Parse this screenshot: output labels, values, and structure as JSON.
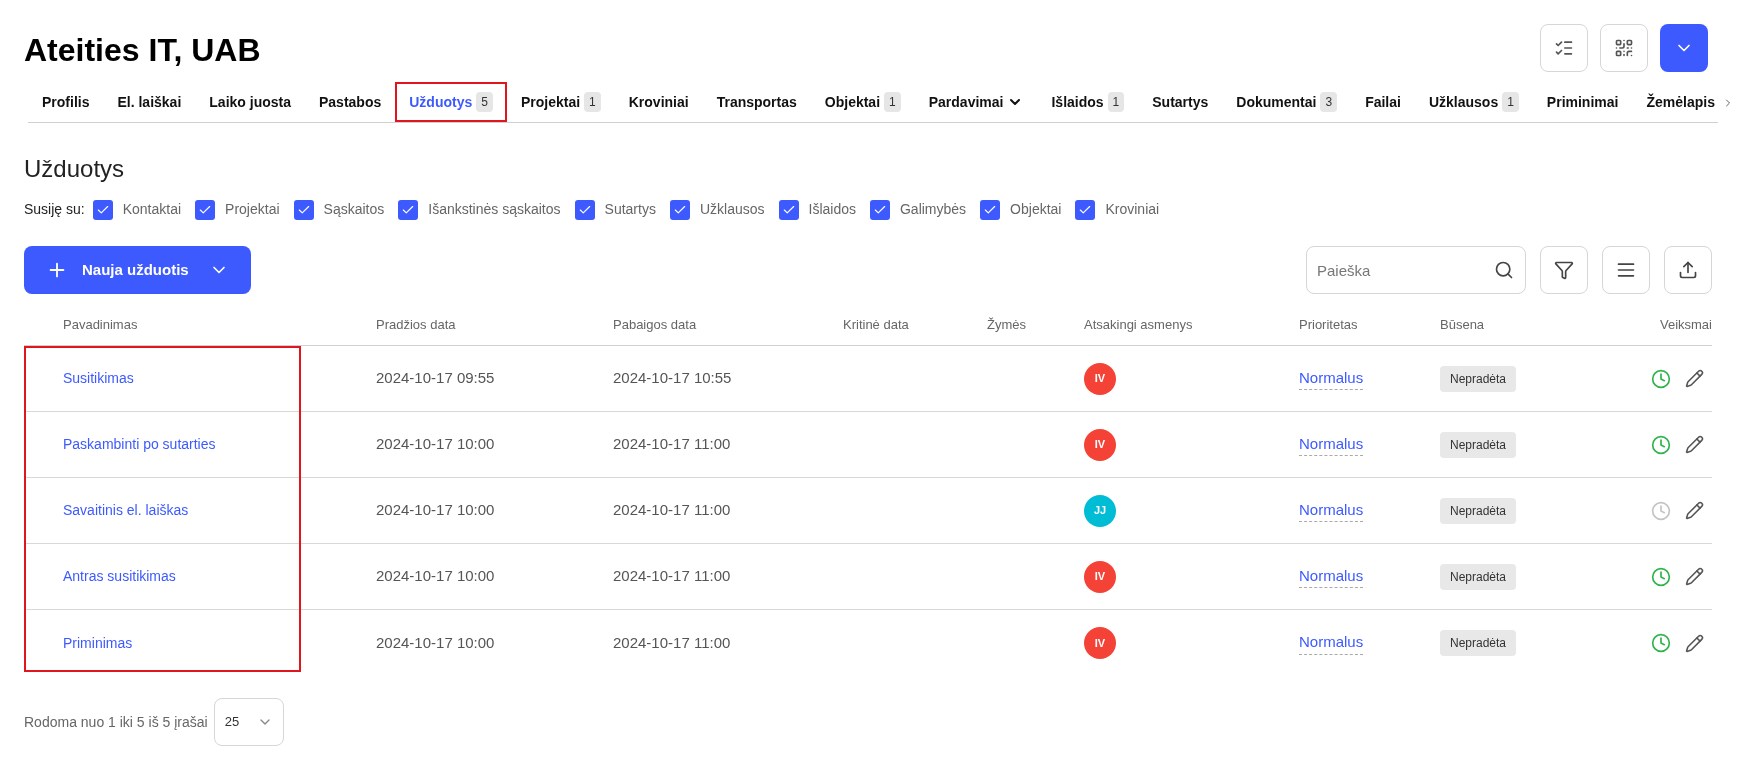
{
  "company": {
    "title": "Ateities IT, UAB"
  },
  "header_buttons": [
    {
      "kind": "checklist"
    },
    {
      "kind": "qr"
    },
    {
      "kind": "dropdown"
    }
  ],
  "tabs": [
    {
      "label": "Profilis",
      "selected": false,
      "highlighted": false
    },
    {
      "label": "El. laiškai",
      "selected": false,
      "highlighted": false
    },
    {
      "label": "Laiko juosta",
      "selected": false,
      "highlighted": false
    },
    {
      "label": "Pastabos",
      "selected": false,
      "highlighted": false
    },
    {
      "label": "Užduotys",
      "count": "5",
      "selected": true,
      "highlighted": true
    },
    {
      "label": "Projektai",
      "count": "1",
      "selected": false,
      "highlighted": false
    },
    {
      "label": "Kroviniai",
      "selected": false,
      "highlighted": false
    },
    {
      "label": "Transportas",
      "selected": false,
      "highlighted": false
    },
    {
      "label": "Objektai",
      "count": "1",
      "selected": false,
      "highlighted": false
    },
    {
      "label": "Pardavimai",
      "dropdown": true,
      "selected": false,
      "highlighted": false
    },
    {
      "label": "Išlaidos",
      "count": "1",
      "selected": false,
      "highlighted": false
    },
    {
      "label": "Sutartys",
      "selected": false,
      "highlighted": false
    },
    {
      "label": "Dokumentai",
      "count": "3",
      "selected": false,
      "highlighted": false
    },
    {
      "label": "Failai",
      "selected": false,
      "highlighted": false
    },
    {
      "label": "Užklausos",
      "count": "1",
      "selected": false,
      "highlighted": false
    },
    {
      "label": "Priminimai",
      "selected": false,
      "highlighted": false
    },
    {
      "label": "Žemėlapis",
      "selected": false,
      "highlighted": false
    }
  ],
  "section": {
    "title": "Užduotys"
  },
  "related": {
    "label": "Susiję su:",
    "options": [
      {
        "label": "Kontaktai",
        "checked": true
      },
      {
        "label": "Projektai",
        "checked": true
      },
      {
        "label": "Sąskaitos",
        "checked": true
      },
      {
        "label": "Išankstinės sąskaitos",
        "checked": true
      },
      {
        "label": "Sutartys",
        "checked": true
      },
      {
        "label": "Užklausos",
        "checked": true
      },
      {
        "label": "Išlaidos",
        "checked": true
      },
      {
        "label": "Galimybės",
        "checked": true
      },
      {
        "label": "Objektai",
        "checked": true
      },
      {
        "label": "Kroviniai",
        "checked": true
      }
    ]
  },
  "new_button": {
    "label": "Nauja užduotis"
  },
  "search": {
    "placeholder": "Paieška"
  },
  "toolbar_buttons": [
    {
      "kind": "filter"
    },
    {
      "kind": "columns"
    },
    {
      "kind": "export"
    }
  ],
  "table": {
    "names_highlighted": true,
    "columns": [
      "Pavadinimas",
      "Pradžios data",
      "Pabaigos data",
      "Kritinė data",
      "Žymės",
      "Atsakingi asmenys",
      "Prioritetas",
      "Būsena",
      "Veiksmai"
    ],
    "rows": [
      {
        "name": "Susitikimas",
        "start": "2024-10-17 09:55",
        "end": "2024-10-17 10:55",
        "assignee": "IV",
        "color": "#f44336",
        "priority": "Normalus",
        "status": "Nepradėta",
        "timer_active": true
      },
      {
        "name": "Paskambinti po sutarties",
        "start": "2024-10-17 10:00",
        "end": "2024-10-17 11:00",
        "assignee": "IV",
        "color": "#f44336",
        "priority": "Normalus",
        "status": "Nepradėta",
        "timer_active": true
      },
      {
        "name": "Savaitinis el. laiškas",
        "start": "2024-10-17 10:00",
        "end": "2024-10-17 11:00",
        "assignee": "JJ",
        "color": "#00bcd4",
        "priority": "Normalus",
        "status": "Nepradėta",
        "timer_active": false
      },
      {
        "name": "Antras susitikimas",
        "start": "2024-10-17 10:00",
        "end": "2024-10-17 11:00",
        "assignee": "IV",
        "color": "#f44336",
        "priority": "Normalus",
        "status": "Nepradėta",
        "timer_active": true
      },
      {
        "name": "Priminimas",
        "start": "2024-10-17 10:00",
        "end": "2024-10-17 11:00",
        "assignee": "IV",
        "color": "#f44336",
        "priority": "Normalus",
        "status": "Nepradėta",
        "timer_active": true
      }
    ]
  },
  "pagination": {
    "summary": "Rodoma nuo 1 iki 5 iš 5 įrašai",
    "page_size": "25"
  }
}
